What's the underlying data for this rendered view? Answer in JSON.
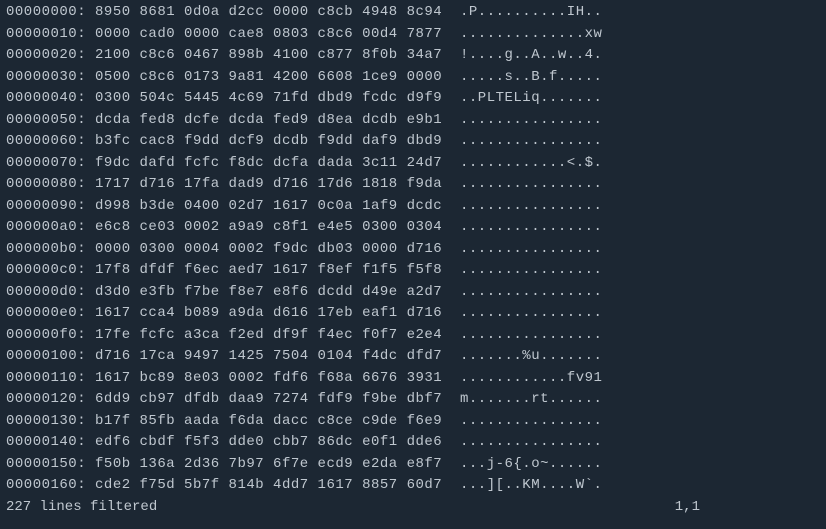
{
  "hexdump": {
    "lines": [
      {
        "offset": "00000000:",
        "hex": "8950 8681 0d0a d2cc 0000 c8cb 4948 8c94",
        "ascii": ".P..........IH.."
      },
      {
        "offset": "00000010:",
        "hex": "0000 cad0 0000 cae8 0803 c8c6 00d4 7877",
        "ascii": "..............xw"
      },
      {
        "offset": "00000020:",
        "hex": "2100 c8c6 0467 898b 4100 c877 8f0b 34a7",
        "ascii": "!....g..A..w..4."
      },
      {
        "offset": "00000030:",
        "hex": "0500 c8c6 0173 9a81 4200 6608 1ce9 0000",
        "ascii": ".....s..B.f....."
      },
      {
        "offset": "00000040:",
        "hex": "0300 504c 5445 4c69 71fd dbd9 fcdc d9f9",
        "ascii": "..PLTELiq......."
      },
      {
        "offset": "00000050:",
        "hex": "dcda fed8 dcfe dcda fed9 d8ea dcdb e9b1",
        "ascii": "................"
      },
      {
        "offset": "00000060:",
        "hex": "b3fc cac8 f9dd dcf9 dcdb f9dd daf9 dbd9",
        "ascii": "................"
      },
      {
        "offset": "00000070:",
        "hex": "f9dc dafd fcfc f8dc dcfa dada 3c11 24d7",
        "ascii": "............<.$."
      },
      {
        "offset": "00000080:",
        "hex": "1717 d716 17fa dad9 d716 17d6 1818 f9da",
        "ascii": "................"
      },
      {
        "offset": "00000090:",
        "hex": "d998 b3de 0400 02d7 1617 0c0a 1af9 dcdc",
        "ascii": "................"
      },
      {
        "offset": "000000a0:",
        "hex": "e6c8 ce03 0002 a9a9 c8f1 e4e5 0300 0304",
        "ascii": "................"
      },
      {
        "offset": "000000b0:",
        "hex": "0000 0300 0004 0002 f9dc db03 0000 d716",
        "ascii": "................"
      },
      {
        "offset": "000000c0:",
        "hex": "17f8 dfdf f6ec aed7 1617 f8ef f1f5 f5f8",
        "ascii": "................"
      },
      {
        "offset": "000000d0:",
        "hex": "d3d0 e3fb f7be f8e7 e8f6 dcdd d49e a2d7",
        "ascii": "................"
      },
      {
        "offset": "000000e0:",
        "hex": "1617 cca4 b089 a9da d616 17eb eaf1 d716",
        "ascii": "................"
      },
      {
        "offset": "000000f0:",
        "hex": "17fe fcfc a3ca f2ed df9f f4ec f0f7 e2e4",
        "ascii": "................"
      },
      {
        "offset": "00000100:",
        "hex": "d716 17ca 9497 1425 7504 0104 f4dc dfd7",
        "ascii": ".......%u......."
      },
      {
        "offset": "00000110:",
        "hex": "1617 bc89 8e03 0002 fdf6 f68a 6676 3931",
        "ascii": "............fv91"
      },
      {
        "offset": "00000120:",
        "hex": "6dd9 cb97 dfdb daa9 7274 fdf9 f9be dbf7",
        "ascii": "m.......rt......"
      },
      {
        "offset": "00000130:",
        "hex": "b17f 85fb aada f6da dacc c8ce c9de f6e9",
        "ascii": "................"
      },
      {
        "offset": "00000140:",
        "hex": "edf6 cbdf f5f3 dde0 cbb7 86dc e0f1 dde6",
        "ascii": "................"
      },
      {
        "offset": "00000150:",
        "hex": "f50b 136a 2d36 7b97 6f7e ecd9 e2da e8f7",
        "ascii": "...j-6{.o~......"
      },
      {
        "offset": "00000160:",
        "hex": "cde2 f75d 5b7f 814b 4dd7 1617 8857 60d7",
        "ascii": "...][..KM....W`."
      }
    ]
  },
  "status": {
    "filter_msg": "227 lines filtered",
    "position": "1,1"
  }
}
